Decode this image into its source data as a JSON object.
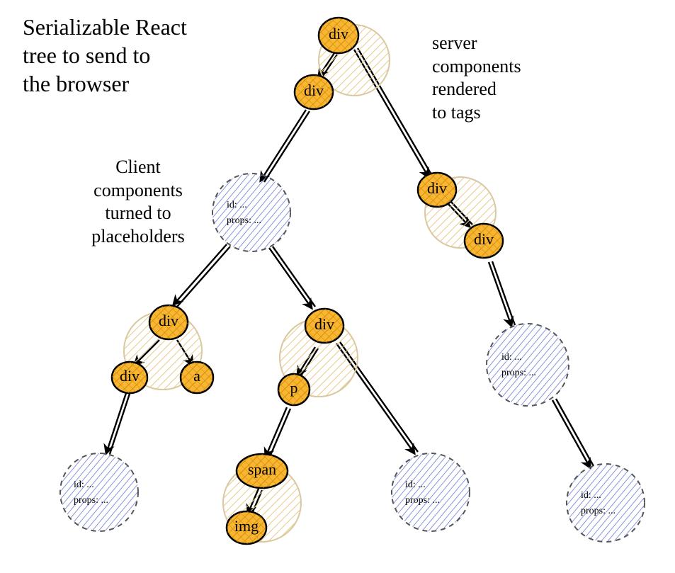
{
  "title": "Serializable React\ntree to send to\nthe browser",
  "annotation_right": "server\ncomponents\nrendered\nto tags",
  "annotation_left": "Client\ncomponents\nturned to\nplaceholders",
  "tag": {
    "div": "div",
    "a": "a",
    "p": "p",
    "span": "span",
    "img": "img"
  },
  "placeholder": {
    "line1": "id: ...",
    "line2": "props: ..."
  },
  "chart_data": {
    "type": "tree",
    "title": "Serializable React tree to send to the browser",
    "annotations": [
      "server components rendered to tags",
      "Client components turned to placeholders"
    ],
    "node_types": {
      "tag": "server component rendered to HTML tag (orange solid circle, with faded backdrop = original server component)",
      "placeholder": "client component placeholder (blue hatched dashed circle) containing {id, props}"
    },
    "nodes": [
      {
        "id": "root",
        "type": "tag",
        "label": "div"
      },
      {
        "id": "n1",
        "type": "tag",
        "label": "div",
        "parent": "root"
      },
      {
        "id": "ph1",
        "type": "placeholder",
        "label": "id / props",
        "parent": "n1"
      },
      {
        "id": "n_right1",
        "type": "tag",
        "label": "div",
        "parent": "root"
      },
      {
        "id": "n_right2",
        "type": "tag",
        "label": "div",
        "parent": "n_right1"
      },
      {
        "id": "ph_right",
        "type": "placeholder",
        "label": "id / props",
        "parent": "n_right2"
      },
      {
        "id": "ph_right_leaf",
        "type": "placeholder",
        "label": "id / props",
        "parent": "ph_right"
      },
      {
        "id": "nL",
        "type": "tag",
        "label": "div",
        "parent": "ph1"
      },
      {
        "id": "nL1",
        "type": "tag",
        "label": "div",
        "parent": "nL"
      },
      {
        "id": "nL2",
        "type": "tag",
        "label": "a",
        "parent": "nL"
      },
      {
        "id": "phL",
        "type": "placeholder",
        "label": "id / props",
        "parent": "nL1"
      },
      {
        "id": "nM",
        "type": "tag",
        "label": "div",
        "parent": "ph1"
      },
      {
        "id": "nMp",
        "type": "tag",
        "label": "p",
        "parent": "nM"
      },
      {
        "id": "nMspan",
        "type": "tag",
        "label": "span",
        "parent": "nMp"
      },
      {
        "id": "nMimg",
        "type": "tag",
        "label": "img",
        "parent": "nMspan"
      },
      {
        "id": "phM",
        "type": "placeholder",
        "label": "id / props",
        "parent": "nM"
      }
    ]
  }
}
